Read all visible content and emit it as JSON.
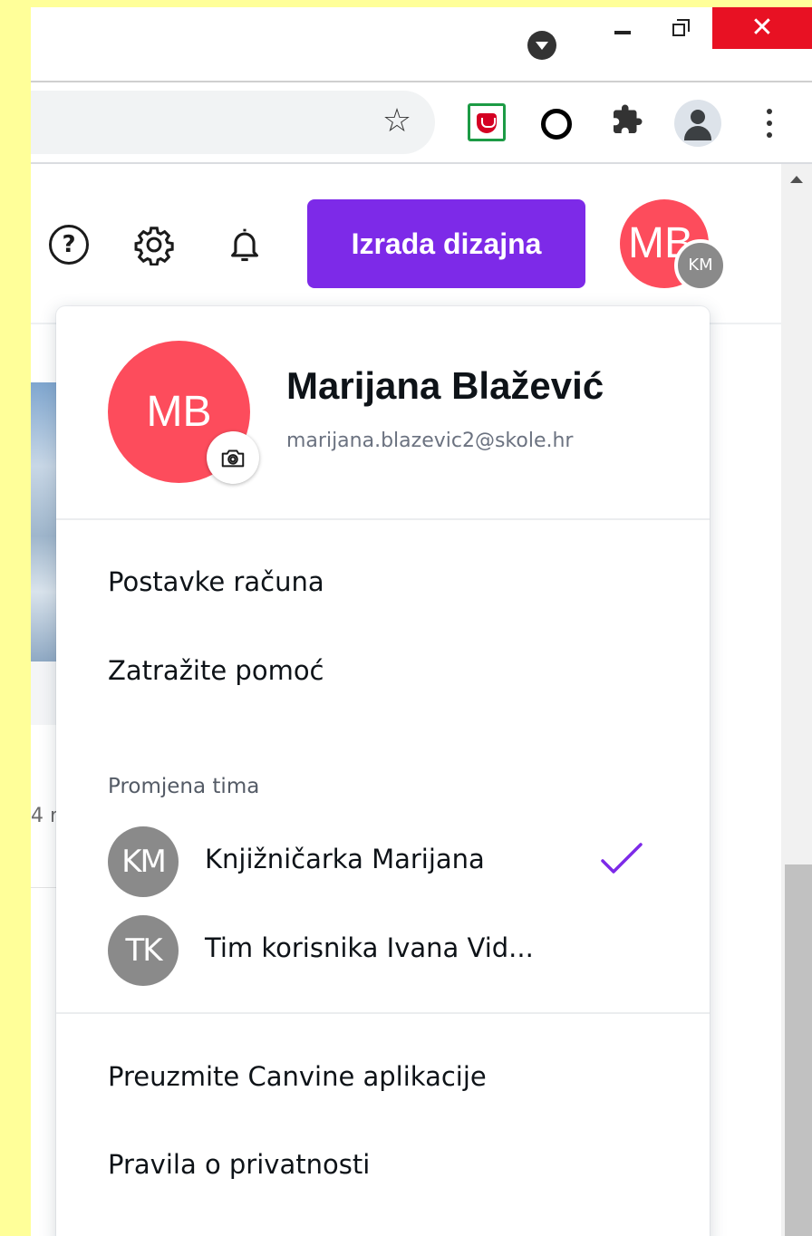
{
  "header": {
    "create_button_label": "Izrada dizajna",
    "avatar_initials": "MB",
    "team_badge_initials": "KM"
  },
  "user": {
    "initials": "MB",
    "name": "Marijana Blažević",
    "email": "marijana.blazevic2@skole.hr"
  },
  "menu": {
    "items_top": [
      {
        "label": "Postavke računa"
      },
      {
        "label": "Zatražite pomoć"
      }
    ],
    "team_section_label": "Promjena tima",
    "teams": [
      {
        "initials": "KM",
        "name": "Knjižničarka Marijana",
        "selected": true
      },
      {
        "initials": "TK",
        "name": "Tim korisnika Ivana Vid...",
        "selected": false
      }
    ],
    "items_bottom": [
      {
        "label": "Preuzmite Canvine aplikacije"
      },
      {
        "label": "Pravila o privatnosti"
      }
    ]
  },
  "background": {
    "partial_text": "4 r"
  },
  "colors": {
    "accent": "#7d2ae8",
    "avatar_red": "#fd4c5c",
    "team_gray": "#8a8a8a",
    "close_red": "#e81123"
  },
  "icons": {
    "window_close": "close-icon",
    "window_min": "minimize-icon",
    "window_max": "restore-icon",
    "bookmark": "star-icon",
    "help": "help-icon",
    "settings": "gear-icon",
    "notifications": "bell-icon",
    "camera": "camera-icon",
    "check": "checkmark-icon"
  }
}
